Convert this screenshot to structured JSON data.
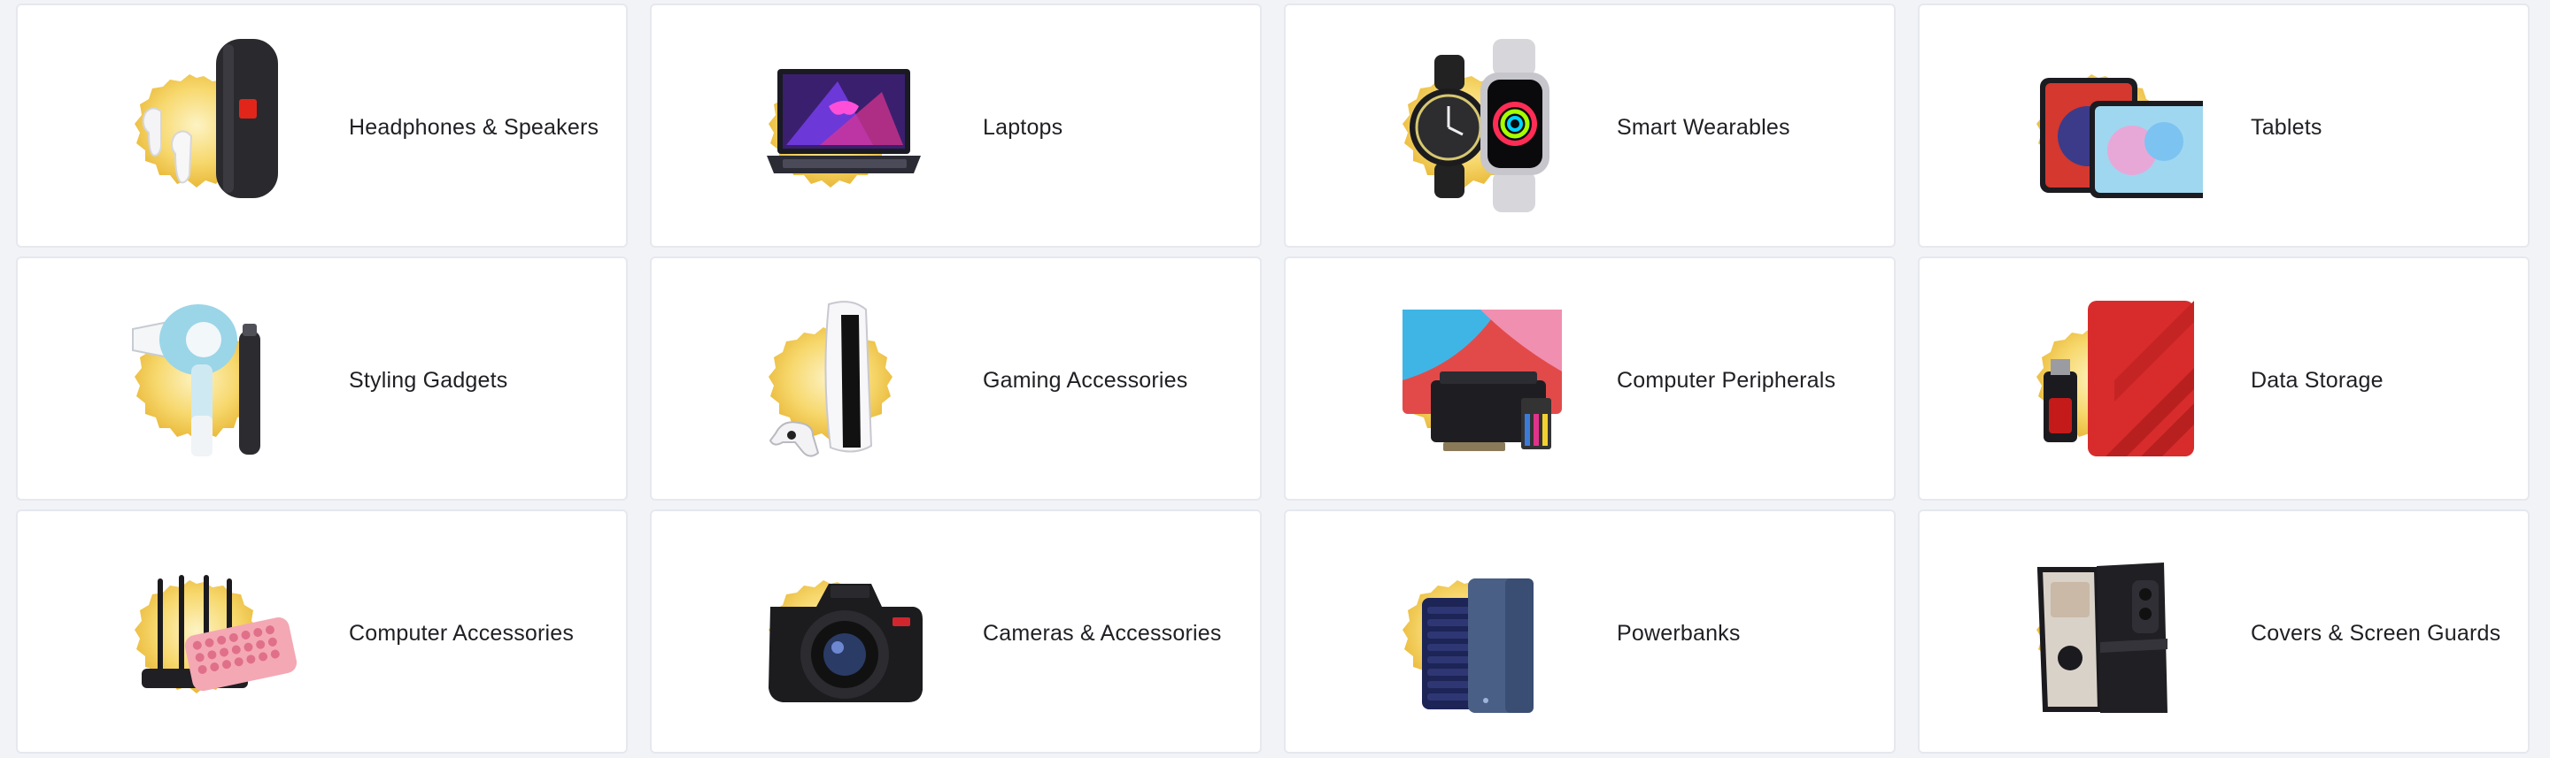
{
  "categories": [
    {
      "label": "Headphones & Speakers",
      "icon": "headphones-speaker-icon"
    },
    {
      "label": "Laptops",
      "icon": "laptop-icon"
    },
    {
      "label": "Smart Wearables",
      "icon": "smartwatch-icon"
    },
    {
      "label": "Tablets",
      "icon": "tablet-icon"
    },
    {
      "label": "Styling Gadgets",
      "icon": "hair-dryer-icon"
    },
    {
      "label": "Gaming Accessories",
      "icon": "game-console-icon"
    },
    {
      "label": "Computer Peripherals",
      "icon": "printer-icon"
    },
    {
      "label": "Data Storage",
      "icon": "hard-drive-icon"
    },
    {
      "label": "Computer Accessories",
      "icon": "router-keyboard-icon"
    },
    {
      "label": "Cameras & Accessories",
      "icon": "camera-icon"
    },
    {
      "label": "Powerbanks",
      "icon": "powerbank-icon"
    },
    {
      "label": "Covers & Screen Guards",
      "icon": "phone-cover-icon"
    }
  ],
  "colors": {
    "badge_gold": "#f5c542",
    "badge_light": "#fbe7a3",
    "card_border": "#e6e8ee",
    "page_bg": "#f1f3f7",
    "text": "#1f1f24"
  }
}
